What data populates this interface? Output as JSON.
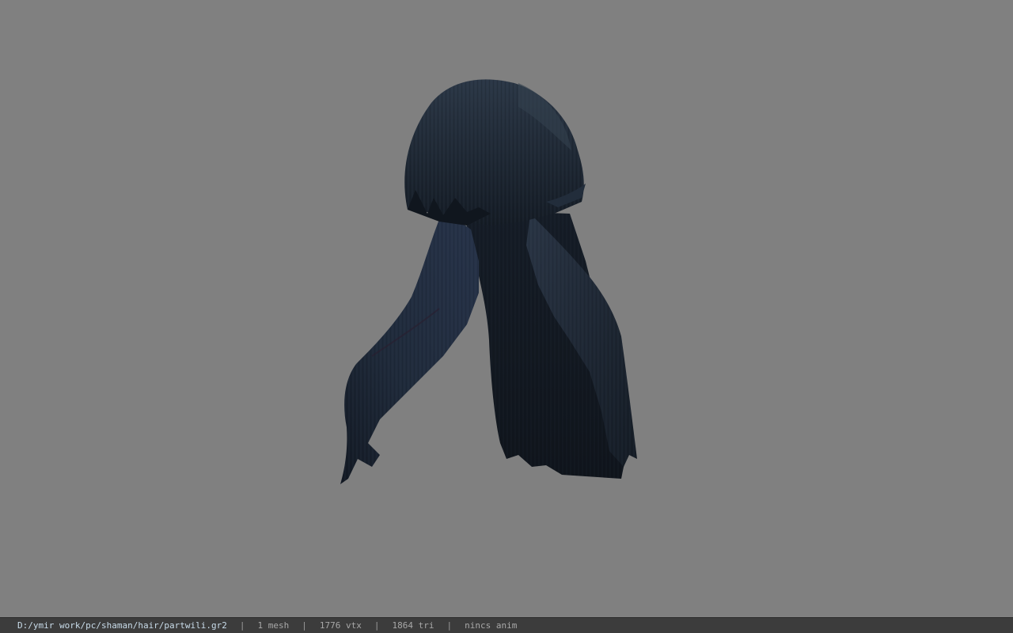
{
  "viewer": {
    "background_color": "#808080",
    "model_color": "#1b2530",
    "model_icon": "hair-mesh-icon"
  },
  "status": {
    "file_path": "D:/ymir work/pc/shaman/hair/partwili.gr2",
    "separator": "|",
    "mesh_count": "1 mesh",
    "vertex_count": "1776 vtx",
    "triangle_count": "1864 tri",
    "anim_status": "nincs anim"
  }
}
